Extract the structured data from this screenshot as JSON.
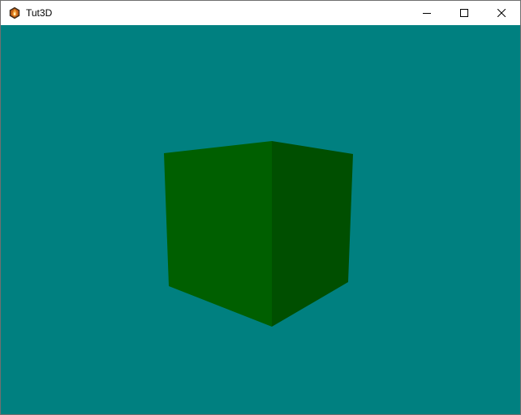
{
  "window": {
    "title": "Tut3D",
    "app_icon": "app-flame-icon",
    "controls": {
      "minimize_icon": "minimize-icon",
      "maximize_icon": "maximize-icon",
      "close_icon": "close-icon"
    }
  },
  "viewport": {
    "background_color": "#008080",
    "cube": {
      "front_face_color": "#005f00",
      "side_face_color": "#004f00"
    }
  }
}
